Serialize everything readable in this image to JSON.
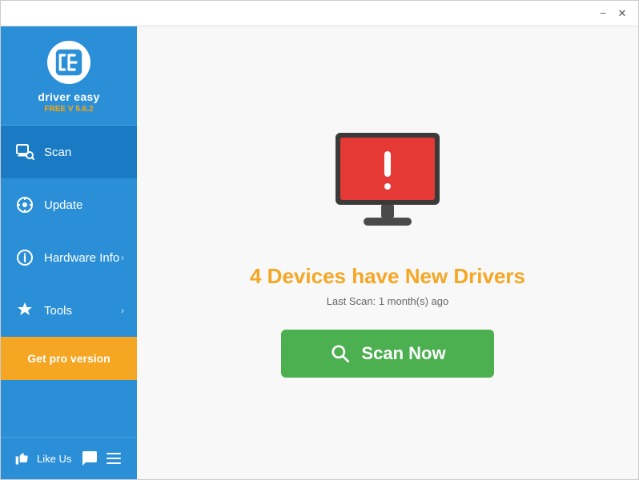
{
  "window": {
    "title": "Driver Easy"
  },
  "titlebar": {
    "minimize_label": "−",
    "close_label": "✕"
  },
  "sidebar": {
    "logo_text": "driver easy",
    "version": "FREE V 5.6.2",
    "nav_items": [
      {
        "id": "scan",
        "label": "Scan",
        "active": true,
        "has_chevron": false
      },
      {
        "id": "update",
        "label": "Update",
        "active": false,
        "has_chevron": false
      },
      {
        "id": "hardware-info",
        "label": "Hardware Info",
        "active": false,
        "has_chevron": true
      },
      {
        "id": "tools",
        "label": "Tools",
        "active": false,
        "has_chevron": true
      }
    ],
    "get_pro_label": "Get pro version",
    "like_us_label": "Like Us"
  },
  "main": {
    "headline": "4 Devices have New Drivers",
    "last_scan_label": "Last Scan:",
    "last_scan_value": "1 month(s) ago",
    "scan_btn_label": "Scan Now"
  },
  "colors": {
    "sidebar_blue": "#2b8fd8",
    "active_blue": "#1a7bc4",
    "orange": "#f5a623",
    "green": "#4caf50",
    "white": "#ffffff"
  }
}
